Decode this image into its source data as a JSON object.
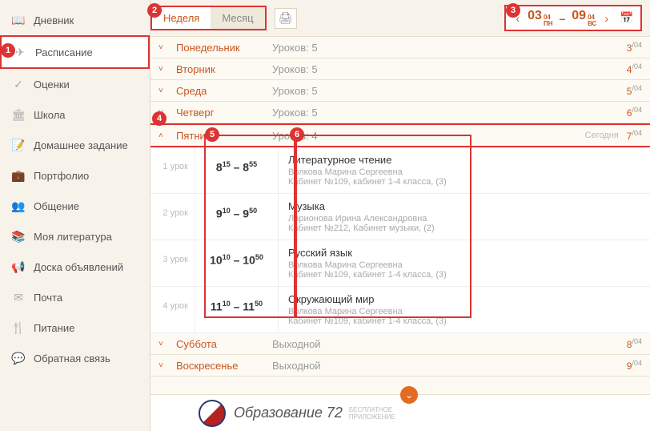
{
  "sidebar": {
    "items": [
      {
        "label": "Дневник",
        "icon": "📖"
      },
      {
        "label": "Расписание",
        "icon": "✈"
      },
      {
        "label": "Оценки",
        "icon": "✓"
      },
      {
        "label": "Школа",
        "icon": "🏛"
      },
      {
        "label": "Домашнее задание",
        "icon": "📝"
      },
      {
        "label": "Портфолио",
        "icon": "💼"
      },
      {
        "label": "Общение",
        "icon": "👥"
      },
      {
        "label": "Моя литература",
        "icon": "📚"
      },
      {
        "label": "Доска объявлений",
        "icon": "📢"
      },
      {
        "label": "Почта",
        "icon": "✉"
      },
      {
        "label": "Питание",
        "icon": "🍴"
      },
      {
        "label": "Обратная связь",
        "icon": "💬"
      }
    ],
    "active_index": 1
  },
  "toolbar": {
    "tabs": {
      "week": "Неделя",
      "month": "Месяц"
    },
    "date_nav": {
      "start_day": "03",
      "start_sup1": "04",
      "start_sup2": "ПН",
      "end_day": "09",
      "end_sup1": "04",
      "end_sup2": "ВС",
      "sep": "–"
    }
  },
  "days": [
    {
      "name": "Понедельник",
      "lessons": "Уроков: 5",
      "date": "3",
      "date_sup": "/04"
    },
    {
      "name": "Вторник",
      "lessons": "Уроков: 5",
      "date": "4",
      "date_sup": "/04"
    },
    {
      "name": "Среда",
      "lessons": "Уроков: 5",
      "date": "5",
      "date_sup": "/04"
    },
    {
      "name": "Четверг",
      "lessons": "Уроков: 5",
      "date": "6",
      "date_sup": "/04"
    },
    {
      "name": "Пятница",
      "lessons": "Уроков: 4",
      "date": "7",
      "date_sup": "/04",
      "expanded": true,
      "today": "Сегодня"
    },
    {
      "name": "Суббота",
      "lessons": "Выходной",
      "date": "8",
      "date_sup": "/04"
    },
    {
      "name": "Воскресенье",
      "lessons": "Выходной",
      "date": "9",
      "date_sup": "/04"
    }
  ],
  "lessons": [
    {
      "num": "1 урок",
      "time_start": "8",
      "time_start_sup": "15",
      "time_end": "8",
      "time_end_sup": "55",
      "subject": "Литературное чтение",
      "teacher": "Волкова Марина Сергеевна",
      "room": "Кабинет №109, кабинет 1-4 класса, (3)"
    },
    {
      "num": "2 урок",
      "time_start": "9",
      "time_start_sup": "10",
      "time_end": "9",
      "time_end_sup": "50",
      "subject": "Музыка",
      "teacher": "Ларионова Ирина Александровна",
      "room": "Кабинет №212, Кабинет музыки, (2)"
    },
    {
      "num": "3 урок",
      "time_start": "10",
      "time_start_sup": "10",
      "time_end": "10",
      "time_end_sup": "50",
      "subject": "Русский язык",
      "teacher": "Волкова Марина Сергеевна",
      "room": "Кабинет №109, кабинет 1-4 класса, (3)"
    },
    {
      "num": "4 урок",
      "time_start": "11",
      "time_start_sup": "10",
      "time_end": "11",
      "time_end_sup": "50",
      "subject": "Окружающий мир",
      "teacher": "Волкова Марина Сергеевна",
      "room": "Кабинет №109, кабинет 1-4 класса, (3)"
    }
  ],
  "banner": {
    "title": "Образование 72",
    "sub1": "БЕСПЛАТНОЕ",
    "sub2": "ПРИЛОЖЕНИЕ"
  },
  "callouts": {
    "c1": "1",
    "c2": "2",
    "c3": "3",
    "c4": "4",
    "c5": "5",
    "c6": "6"
  }
}
